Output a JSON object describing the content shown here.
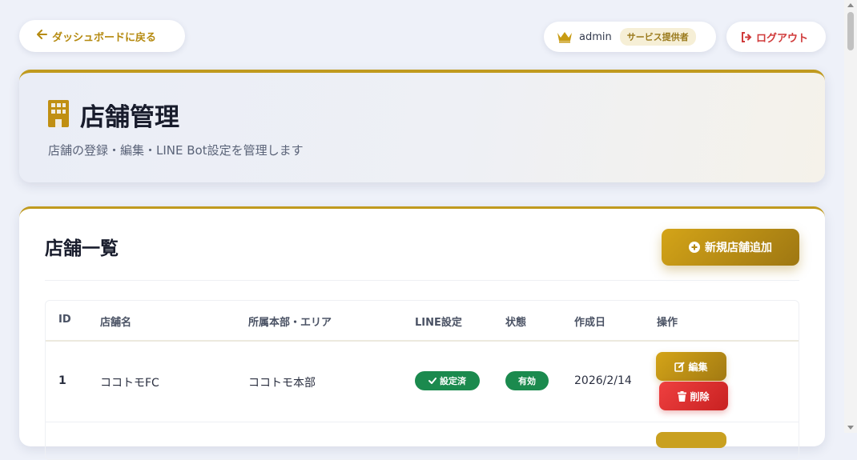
{
  "topbar": {
    "back_label": "ダッシュボードに戻る",
    "username": "admin",
    "role": "サービス提供者",
    "logout_label": "ログアウト"
  },
  "header": {
    "title": "店舗管理",
    "subtitle": "店舗の登録・編集・LINE Bot設定を管理します",
    "icon": "building-icon"
  },
  "list": {
    "title": "店舗一覧",
    "add_label": "新規店舗追加",
    "columns": [
      "ID",
      "店舗名",
      "所属本部・エリア",
      "LINE設定",
      "状態",
      "作成日",
      "操作"
    ],
    "rows": [
      {
        "id": "1",
        "name": "ココトモFC",
        "area": "ココトモ本部",
        "line_status": "設定済",
        "state": "有効",
        "created": "2026/2/14",
        "edit_label": "編集",
        "delete_label": "削除"
      }
    ]
  },
  "colors": {
    "accent_gold": "#c09a1e",
    "success_green": "#1b8a4e",
    "danger_red": "#d03a3a"
  }
}
